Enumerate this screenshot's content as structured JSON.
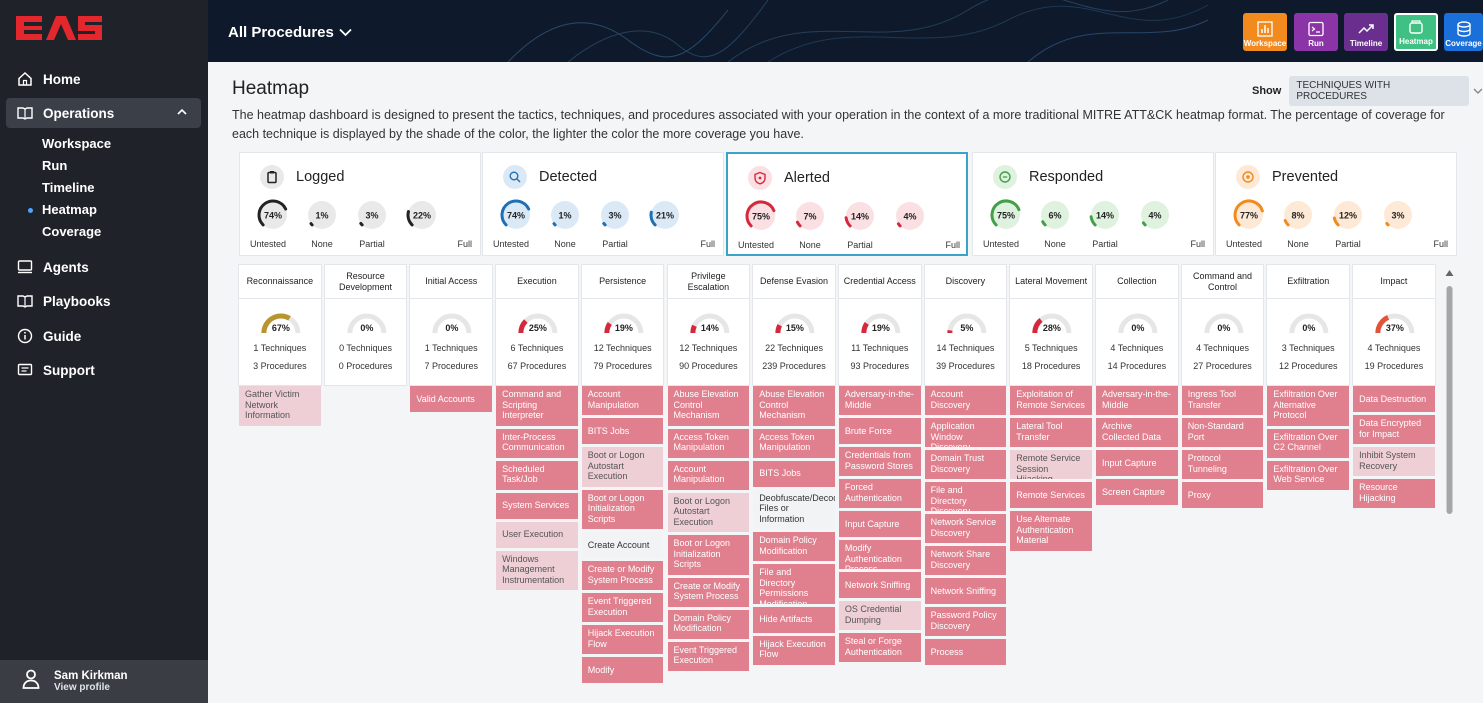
{
  "app": {
    "logo_text": "EAS"
  },
  "sidebar": {
    "items": [
      {
        "label": "Home",
        "icon": "home-icon"
      },
      {
        "label": "Operations",
        "icon": "book-icon"
      },
      {
        "label": "Agents",
        "icon": "monitor-icon"
      },
      {
        "label": "Playbooks",
        "icon": "book-open-icon"
      },
      {
        "label": "Guide",
        "icon": "info-icon"
      },
      {
        "label": "Support",
        "icon": "chat-icon"
      }
    ],
    "sub_items": [
      "Workspace",
      "Run",
      "Timeline",
      "Heatmap",
      "Coverage"
    ],
    "active_sub": "Heatmap",
    "user": {
      "name": "Sam Kirkman",
      "profile_link": "View profile"
    }
  },
  "topbar": {
    "title": "All Procedures",
    "buttons": [
      {
        "label": "Workspace",
        "color": "#f28a1e"
      },
      {
        "label": "Run",
        "color": "#8b34a8"
      },
      {
        "label": "Timeline",
        "color": "#6a2e8e"
      },
      {
        "label": "Heatmap",
        "color": "#3fc183"
      },
      {
        "label": "Coverage",
        "color": "#1a6fd8"
      }
    ]
  },
  "page": {
    "title": "Heatmap",
    "show_label": "Show",
    "show_value": "TECHNIQUES WITH PROCEDURES",
    "description": "The heatmap dashboard is designed to present the tactics, techniques, and procedures associated with your operation in the context of a more traditional MITRE ATT&CK heatmap format. The percentage of coverage for each technique is displayed by the shade of the color, the lighter the color the more coverage you have."
  },
  "summary": [
    {
      "title": "Logged",
      "color": "#222222",
      "icon": "clipboard-icon",
      "gauges": [
        {
          "value": 74,
          "label": "Untested"
        },
        {
          "value": 1,
          "label": "None"
        },
        {
          "value": 3,
          "label": "Partial"
        },
        {
          "value": 22,
          "label": "Full"
        }
      ]
    },
    {
      "title": "Detected",
      "color": "#1f6fb5",
      "icon": "search-icon",
      "gauges": [
        {
          "value": 74,
          "label": "Untested"
        },
        {
          "value": 1,
          "label": "None"
        },
        {
          "value": 3,
          "label": "Partial"
        },
        {
          "value": 21,
          "label": "Full"
        }
      ]
    },
    {
      "title": "Alerted",
      "color": "#d6283d",
      "icon": "shield-alert-icon",
      "gauges": [
        {
          "value": 75,
          "label": "Untested"
        },
        {
          "value": 7,
          "label": "None"
        },
        {
          "value": 14,
          "label": "Partial"
        },
        {
          "value": 4,
          "label": "Full"
        }
      ]
    },
    {
      "title": "Responded",
      "color": "#43a047",
      "icon": "chat-bubble-icon",
      "gauges": [
        {
          "value": 75,
          "label": "Untested"
        },
        {
          "value": 6,
          "label": "None"
        },
        {
          "value": 14,
          "label": "Partial"
        },
        {
          "value": 4,
          "label": "Full"
        }
      ]
    },
    {
      "title": "Prevented",
      "color": "#f28a1e",
      "icon": "prevent-icon",
      "gauges": [
        {
          "value": 77,
          "label": "Untested"
        },
        {
          "value": 8,
          "label": "None"
        },
        {
          "value": 12,
          "label": "Partial"
        },
        {
          "value": 3,
          "label": "Full"
        }
      ]
    }
  ],
  "tactics": [
    {
      "name": "Reconnaissance",
      "pct": 67,
      "color": "#b8952f",
      "techniques": "1 Techniques",
      "procedures": "3 Procedures",
      "items": [
        [
          "Gather Victim Network Information",
          "l"
        ]
      ]
    },
    {
      "name": "Resource Development",
      "pct": 0,
      "color": "#d6283d",
      "techniques": "0 Techniques",
      "procedures": "0 Procedures",
      "items": []
    },
    {
      "name": "Initial Access",
      "pct": 0,
      "color": "#d6283d",
      "techniques": "1 Techniques",
      "procedures": "7 Procedures",
      "items": [
        [
          "Valid Accounts",
          "c"
        ]
      ]
    },
    {
      "name": "Execution",
      "pct": 25,
      "color": "#d6283d",
      "techniques": "6 Techniques",
      "procedures": "67 Procedures",
      "items": [
        [
          "Command and Scripting Interpreter",
          "c"
        ],
        [
          "Inter-Process Communication",
          "c"
        ],
        [
          "Scheduled Task/Job",
          "c"
        ],
        [
          "System Services",
          "c"
        ],
        [
          "User Execution",
          "l"
        ],
        [
          "Windows Management Instrumentation",
          "l"
        ]
      ]
    },
    {
      "name": "Persistence",
      "pct": 19,
      "color": "#d6283d",
      "techniques": "12 Techniques",
      "procedures": "79 Procedures",
      "items": [
        [
          "Account Manipulation",
          "c"
        ],
        [
          "BITS Jobs",
          "c"
        ],
        [
          "Boot or Logon Autostart Execution",
          "l"
        ],
        [
          "Boot or Logon Initialization Scripts",
          "c"
        ],
        [
          "Create Account",
          "w"
        ],
        [
          "Create or Modify System Process",
          "c"
        ],
        [
          "Event Triggered Execution",
          "c"
        ],
        [
          "Hijack Execution Flow",
          "c"
        ],
        [
          "Modify",
          "c"
        ]
      ]
    },
    {
      "name": "Privilege Escalation",
      "pct": 14,
      "color": "#d6283d",
      "techniques": "12 Techniques",
      "procedures": "90 Procedures",
      "items": [
        [
          "Abuse Elevation Control Mechanism",
          "c"
        ],
        [
          "Access Token Manipulation",
          "c"
        ],
        [
          "Account Manipulation",
          "c"
        ],
        [
          "Boot or Logon Autostart Execution",
          "l"
        ],
        [
          "Boot or Logon Initialization Scripts",
          "c"
        ],
        [
          "Create or Modify System Process",
          "c"
        ],
        [
          "Domain Policy Modification",
          "c"
        ],
        [
          "Event Triggered Execution",
          "c"
        ]
      ]
    },
    {
      "name": "Defense Evasion",
      "pct": 15,
      "color": "#d6283d",
      "techniques": "22 Techniques",
      "procedures": "239 Procedures",
      "items": [
        [
          "Abuse Elevation Control Mechanism",
          "c"
        ],
        [
          "Access Token Manipulation",
          "c"
        ],
        [
          "BITS Jobs",
          "c"
        ],
        [
          "Deobfuscate/Decode Files or Information",
          "w"
        ],
        [
          "Domain Policy Modification",
          "c"
        ],
        [
          "File and Directory Permissions Modification",
          "c"
        ],
        [
          "Hide Artifacts",
          "c"
        ],
        [
          "Hijack Execution Flow",
          "c"
        ]
      ]
    },
    {
      "name": "Credential Access",
      "pct": 19,
      "color": "#d6283d",
      "techniques": "11 Techniques",
      "procedures": "93 Procedures",
      "items": [
        [
          "Adversary-in-the-Middle",
          "c"
        ],
        [
          "Brute Force",
          "c"
        ],
        [
          "Credentials from Password Stores",
          "c"
        ],
        [
          "Forced Authentication",
          "c"
        ],
        [
          "Input Capture",
          "c"
        ],
        [
          "Modify Authentication Process",
          "c"
        ],
        [
          "Network Sniffing",
          "c"
        ],
        [
          "OS Credential Dumping",
          "l"
        ],
        [
          "Steal or Forge Authentication",
          "c"
        ]
      ]
    },
    {
      "name": "Discovery",
      "pct": 5,
      "color": "#d6283d",
      "techniques": "14 Techniques",
      "procedures": "39 Procedures",
      "items": [
        [
          "Account Discovery",
          "c"
        ],
        [
          "Application Window Discovery",
          "c"
        ],
        [
          "Domain Trust Discovery",
          "c"
        ],
        [
          "File and Directory Discovery",
          "c"
        ],
        [
          "Network Service Discovery",
          "c"
        ],
        [
          "Network Share Discovery",
          "c"
        ],
        [
          "Network Sniffing",
          "c"
        ],
        [
          "Password Policy Discovery",
          "c"
        ],
        [
          "Process",
          "c"
        ]
      ]
    },
    {
      "name": "Lateral Movement",
      "pct": 28,
      "color": "#d6283d",
      "techniques": "5 Techniques",
      "procedures": "18 Procedures",
      "items": [
        [
          "Exploitation of Remote Services",
          "c"
        ],
        [
          "Lateral Tool Transfer",
          "c"
        ],
        [
          "Remote Service Session Hijacking",
          "l"
        ],
        [
          "Remote Services",
          "c"
        ],
        [
          "Use Alternate Authentication Material",
          "c"
        ]
      ]
    },
    {
      "name": "Collection",
      "pct": 0,
      "color": "#d6283d",
      "techniques": "4 Techniques",
      "procedures": "14 Procedures",
      "items": [
        [
          "Adversary-in-the-Middle",
          "c"
        ],
        [
          "Archive Collected Data",
          "c"
        ],
        [
          "Input Capture",
          "c"
        ],
        [
          "Screen Capture",
          "c"
        ]
      ]
    },
    {
      "name": "Command and Control",
      "pct": 0,
      "color": "#d6283d",
      "techniques": "4 Techniques",
      "procedures": "27 Procedures",
      "items": [
        [
          "Ingress Tool Transfer",
          "c"
        ],
        [
          "Non-Standard Port",
          "c"
        ],
        [
          "Protocol Tunneling",
          "c"
        ],
        [
          "Proxy",
          "c"
        ]
      ]
    },
    {
      "name": "Exfiltration",
      "pct": 0,
      "color": "#d6283d",
      "techniques": "3 Techniques",
      "procedures": "12 Procedures",
      "items": [
        [
          "Exfiltration Over Alternative Protocol",
          "c"
        ],
        [
          "Exfiltration Over C2 Channel",
          "c"
        ],
        [
          "Exfiltration Over Web Service",
          "c"
        ]
      ]
    },
    {
      "name": "Impact",
      "pct": 37,
      "color": "#e2543a",
      "techniques": "4 Techniques",
      "procedures": "19 Procedures",
      "items": [
        [
          "Data Destruction",
          "c"
        ],
        [
          "Data Encrypted for Impact",
          "c"
        ],
        [
          "Inhibit System Recovery",
          "l"
        ],
        [
          "Resource Hijacking",
          "c"
        ]
      ]
    }
  ]
}
